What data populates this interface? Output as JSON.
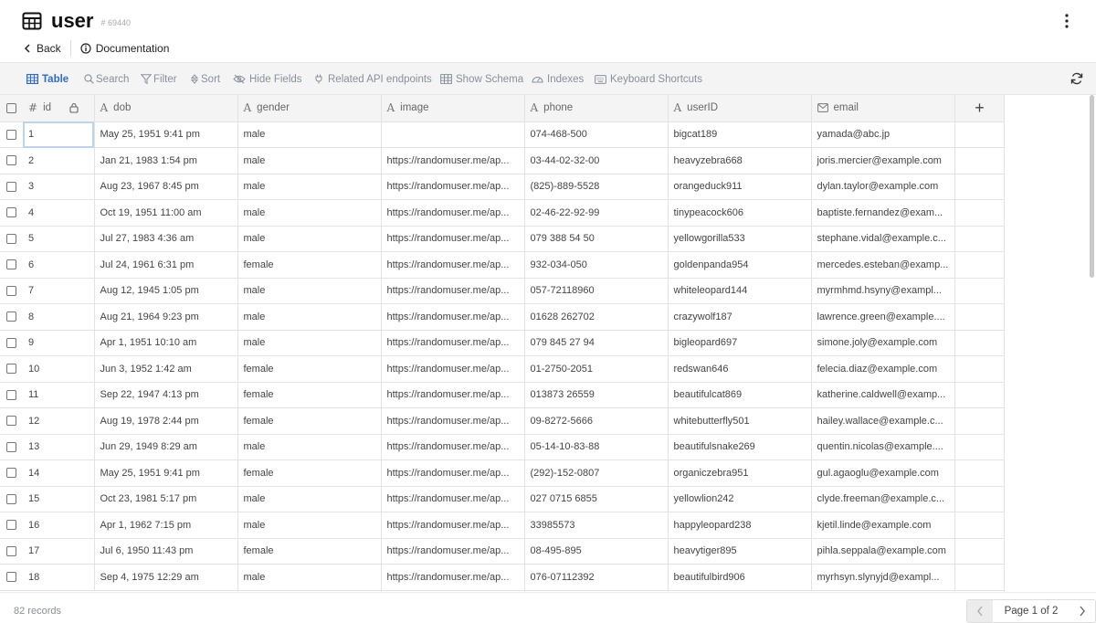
{
  "header": {
    "title": "user",
    "table_id": "# 69440",
    "back_label": "Back",
    "documentation_label": "Documentation"
  },
  "toolbar": {
    "table": "Table",
    "search": "Search",
    "filter": "Filter",
    "sort": "Sort",
    "hide_fields": "Hide Fields",
    "related_api": "Related API endpoints",
    "show_schema": "Show Schema",
    "indexes": "Indexes",
    "keyboard_shortcuts": "Keyboard Shortcuts"
  },
  "columns": [
    {
      "type_glyph": "#",
      "label": "id"
    },
    {
      "type_glyph": "A",
      "label": "dob"
    },
    {
      "type_glyph": "A",
      "label": "gender"
    },
    {
      "type_glyph": "A",
      "label": "image"
    },
    {
      "type_glyph": "A",
      "label": "phone"
    },
    {
      "type_glyph": "A",
      "label": "userID"
    },
    {
      "type_glyph": "mail-icon",
      "label": "email"
    }
  ],
  "add_column_label": "+",
  "rows": [
    [
      "1",
      "May 25, 1951 9:41 pm",
      "male",
      "",
      "074-468-500",
      "bigcat189",
      "yamada@abc.jp"
    ],
    [
      "2",
      "Jan 21, 1983 1:54 pm",
      "male",
      "https://randomuser.me/ap...",
      "03-44-02-32-00",
      "heavyzebra668",
      "joris.mercier@example.com"
    ],
    [
      "3",
      "Aug 23, 1967 8:45 pm",
      "male",
      "https://randomuser.me/ap...",
      "(825)-889-5528",
      "orangeduck911",
      "dylan.taylor@example.com"
    ],
    [
      "4",
      "Oct 19, 1951 11:00 am",
      "male",
      "https://randomuser.me/ap...",
      "02-46-22-92-99",
      "tinypeacock606",
      "baptiste.fernandez@exam..."
    ],
    [
      "5",
      "Jul 27, 1983 4:36 am",
      "male",
      "https://randomuser.me/ap...",
      "079 388 54 50",
      "yellowgorilla533",
      "stephane.vidal@example.c..."
    ],
    [
      "6",
      "Jul 24, 1961 6:31 pm",
      "female",
      "https://randomuser.me/ap...",
      "932-034-050",
      "goldenpanda954",
      "mercedes.esteban@examp..."
    ],
    [
      "7",
      "Aug 12, 1945 1:05 pm",
      "male",
      "https://randomuser.me/ap...",
      "057-72118960",
      "whiteleopard144",
      "myrmhmd.hsyny@exampl..."
    ],
    [
      "8",
      "Aug 21, 1964 9:23 pm",
      "male",
      "https://randomuser.me/ap...",
      "01628 262702",
      "crazywolf187",
      "lawrence.green@example...."
    ],
    [
      "9",
      "Apr 1, 1951 10:10 am",
      "male",
      "https://randomuser.me/ap...",
      "079 845 27 94",
      "bigleopard697",
      "simone.joly@example.com"
    ],
    [
      "10",
      "Jun 3, 1952 1:42 am",
      "female",
      "https://randomuser.me/ap...",
      "01-2750-2051",
      "redswan646",
      "felecia.diaz@example.com"
    ],
    [
      "11",
      "Sep 22, 1947 4:13 pm",
      "female",
      "https://randomuser.me/ap...",
      "013873 26559",
      "beautifulcat869",
      "katherine.caldwell@examp..."
    ],
    [
      "12",
      "Aug 19, 1978 2:44 pm",
      "female",
      "https://randomuser.me/ap...",
      "09-8272-5666",
      "whitebutterfly501",
      "hailey.wallace@example.c..."
    ],
    [
      "13",
      "Jun 29, 1949 8:29 am",
      "male",
      "https://randomuser.me/ap...",
      "05-14-10-83-88",
      "beautifulsnake269",
      "quentin.nicolas@example...."
    ],
    [
      "14",
      "May 25, 1951 9:41 pm",
      "female",
      "https://randomuser.me/ap...",
      "(292)-152-0807",
      "organiczebra951",
      "gul.agaoglu@example.com"
    ],
    [
      "15",
      "Oct 23, 1981 5:17 pm",
      "male",
      "https://randomuser.me/ap...",
      "027 0715 6855",
      "yellowlion242",
      "clyde.freeman@example.c..."
    ],
    [
      "16",
      "Apr 1, 1962 7:15 pm",
      "male",
      "https://randomuser.me/ap...",
      "33985573",
      "happyleopard238",
      "kjetil.linde@example.com"
    ],
    [
      "17",
      "Jul 6, 1950 11:43 pm",
      "female",
      "https://randomuser.me/ap...",
      "08-495-895",
      "heavytiger895",
      "pihla.seppala@example.com"
    ],
    [
      "18",
      "Sep 4, 1975 12:29 am",
      "male",
      "https://randomuser.me/ap...",
      "076-07112392",
      "beautifulbird906",
      "myrhsyn.slynyjd@exampl..."
    ]
  ],
  "footer": {
    "records": "82 records",
    "page_label": "Page 1 of 2"
  },
  "colors": {
    "accent": "#2f6bd8",
    "toolbar_bg": "#f4f4f4",
    "grid_line": "#e3e3e3"
  }
}
